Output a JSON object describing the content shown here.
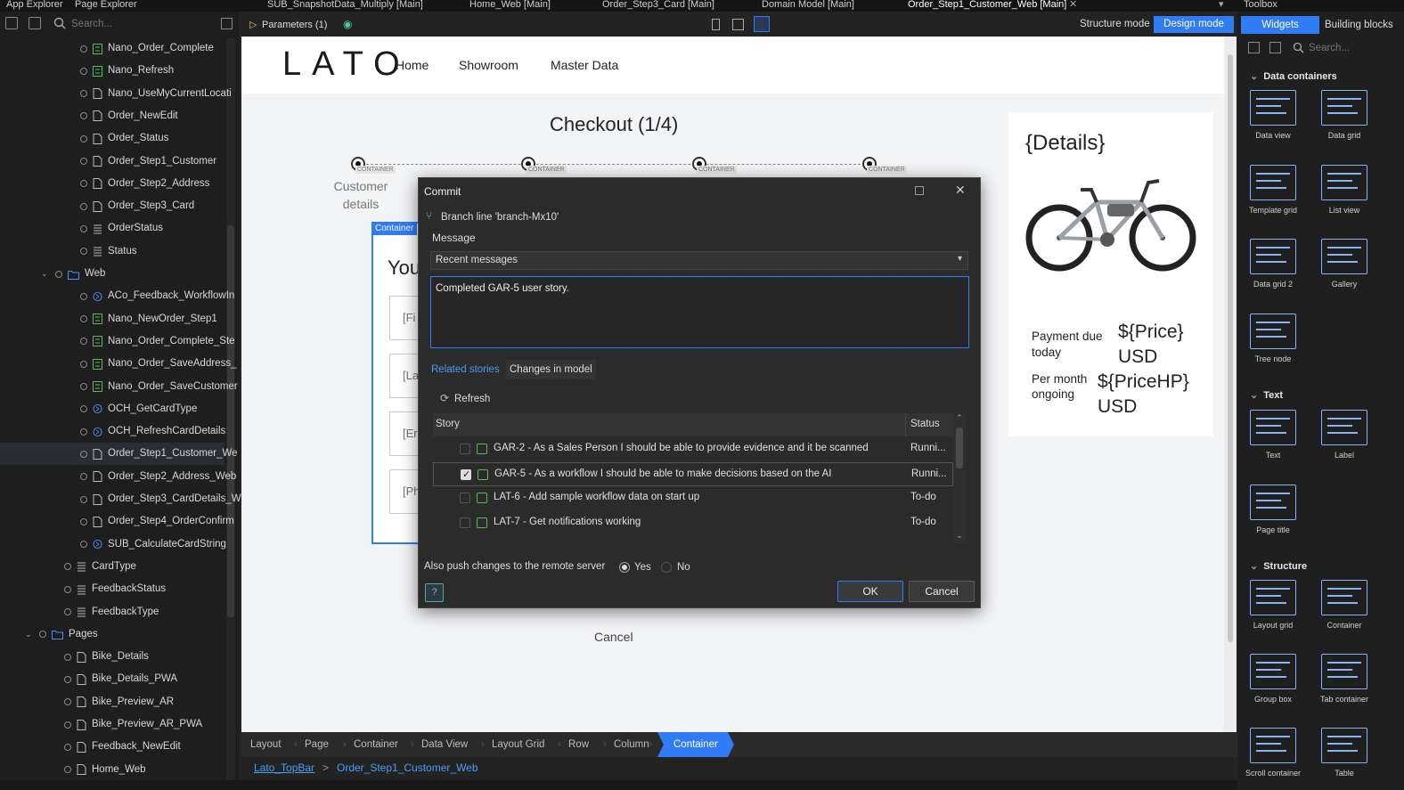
{
  "top_tabs": {
    "app_explorer": "App Explorer",
    "page_explorer": "Page Explorer",
    "doc_tabs": [
      "SUB_SnapshotData_Multiply [Main]",
      "Home_Web [Main]",
      "Order_Step3_Card [Main]",
      "Domain Model [Main]",
      "Order_Step1_Customer_Web [Main]"
    ],
    "toolbox": "Toolbox"
  },
  "left": {
    "search_placeholder": "Search...",
    "items": [
      {
        "label": "Nano_Order_Complete",
        "icon": "nanoflow-icon"
      },
      {
        "label": "Nano_Refresh",
        "icon": "nanoflow-icon"
      },
      {
        "label": "Nano_UseMyCurrentLocati",
        "icon": "page-icon"
      },
      {
        "label": "Order_NewEdit",
        "icon": "page-icon"
      },
      {
        "label": "Order_Status",
        "icon": "page-icon"
      },
      {
        "label": "Order_Step1_Customer",
        "icon": "page-icon"
      },
      {
        "label": "Order_Step2_Address",
        "icon": "page-icon"
      },
      {
        "label": "Order_Step3_Card",
        "icon": "page-icon"
      },
      {
        "label": "OrderStatus",
        "icon": "enum-icon"
      },
      {
        "label": "Status",
        "icon": "enum-icon"
      }
    ],
    "web_folder": "Web",
    "web_items": [
      {
        "label": "ACo_Feedback_WorkflowIn",
        "icon": "microflow-icon"
      },
      {
        "label": "Nano_NewOrder_Step1",
        "icon": "nanoflow-icon"
      },
      {
        "label": "Nano_Order_Complete_Ste",
        "icon": "nanoflow-icon"
      },
      {
        "label": "Nano_Order_SaveAddress_",
        "icon": "nanoflow-icon"
      },
      {
        "label": "Nano_Order_SaveCustomer",
        "icon": "nanoflow-icon"
      },
      {
        "label": "OCH_GetCardType",
        "icon": "microflow-icon"
      },
      {
        "label": "OCH_RefreshCardDetails",
        "icon": "microflow-icon"
      },
      {
        "label": "Order_Step1_Customer_We",
        "icon": "page-icon"
      },
      {
        "label": "Order_Step2_Address_Web",
        "icon": "page-icon"
      },
      {
        "label": "Order_Step3_CardDetails_W",
        "icon": "page-icon"
      },
      {
        "label": "Order_Step4_OrderConfirm",
        "icon": "page-icon"
      },
      {
        "label": "SUB_CalculateCardString",
        "icon": "microflow-icon"
      }
    ],
    "root_items": [
      {
        "label": "CardType",
        "icon": "enum-icon"
      },
      {
        "label": "FeedbackStatus",
        "icon": "enum-icon"
      },
      {
        "label": "FeedbackType",
        "icon": "enum-icon"
      }
    ],
    "pages_folder": "Pages",
    "pages_items": [
      {
        "label": "Bike_Details",
        "icon": "page-icon"
      },
      {
        "label": "Bike_Details_PWA",
        "icon": "page-icon"
      },
      {
        "label": "Bike_Preview_AR",
        "icon": "page-icon"
      },
      {
        "label": "Bike_Preview_AR_PWA",
        "icon": "page-icon"
      },
      {
        "label": "Feedback_NewEdit",
        "icon": "page-icon"
      },
      {
        "label": "Home_Web",
        "icon": "page-icon"
      }
    ]
  },
  "editor_toolbar": {
    "parameters": "Parameters (1)",
    "structure_mode": "Structure mode",
    "design_mode": "Design mode"
  },
  "canvas": {
    "logo": "LATO",
    "nav": [
      "Home",
      "Showroom",
      "Master Data"
    ],
    "checkout_title": "Checkout (1/4)",
    "step_label": "CONTAINER",
    "customer_details": "Customer details",
    "container_tag": "Container",
    "form_heading": "You",
    "fields": [
      "[Fi",
      "[La",
      "[Er",
      "[Ph"
    ],
    "cancel": "Cancel",
    "details_title": "{Details}",
    "payment_due": "Payment due today",
    "price": "${Price} USD",
    "per_month": "Per month ongoing",
    "price_hp": "${PriceHP} USD"
  },
  "dialog": {
    "title": "Commit",
    "branch": "Branch line 'branch-Mx10'",
    "message_label": "Message",
    "recent_messages": "Recent messages",
    "message_value": "Completed GAR-5 user story.",
    "tab_related": "Related stories",
    "tab_changes": "Changes in model",
    "refresh": "Refresh",
    "col_story": "Story",
    "col_status": "Status",
    "stories": [
      {
        "story": "GAR-2 - As a Sales Person I should be able to provide evidence and it be scanned",
        "status": "Runni...",
        "checked": false
      },
      {
        "story": "GAR-5 - As a workflow I should be able to make decisions based on the AI",
        "status": "Runni...",
        "checked": true
      },
      {
        "story": "LAT-6 - Add sample workflow data on start up",
        "status": "To-do",
        "checked": false
      },
      {
        "story": "LAT-7 - Get notifications working",
        "status": "To-do",
        "checked": false
      }
    ],
    "push_label": "Also push changes to the remote server",
    "yes": "Yes",
    "no": "No",
    "push_selected": "Yes",
    "ok": "OK",
    "cancel": "Cancel"
  },
  "breadcrumb": {
    "items": [
      "Layout",
      "Page",
      "Container",
      "Data View",
      "Layout Grid",
      "Row",
      "Column",
      "Container"
    ],
    "active": "Container",
    "links": [
      "Lato_TopBar",
      "Order_Step1_Customer_Web"
    ],
    "sep": ">"
  },
  "toolbox": {
    "tab_widgets": "Widgets",
    "tab_building": "Building blocks",
    "search_placeholder": "Search...",
    "sections": [
      {
        "title": "Data containers",
        "tiles": [
          "Data view",
          "Data grid",
          "Template grid",
          "List view",
          "Data grid 2",
          "Gallery",
          "Tree node"
        ]
      },
      {
        "title": "Text",
        "tiles": [
          "Text",
          "Label",
          "Page title"
        ]
      },
      {
        "title": "Structure",
        "tiles": [
          "Layout grid",
          "Container",
          "Group box",
          "Tab container",
          "Scroll container",
          "Table"
        ]
      }
    ]
  },
  "colors": {
    "accent": "#2f7cf6",
    "dialog_bg": "#2b2b2b",
    "canvas_bg": "#f3f4f6"
  }
}
